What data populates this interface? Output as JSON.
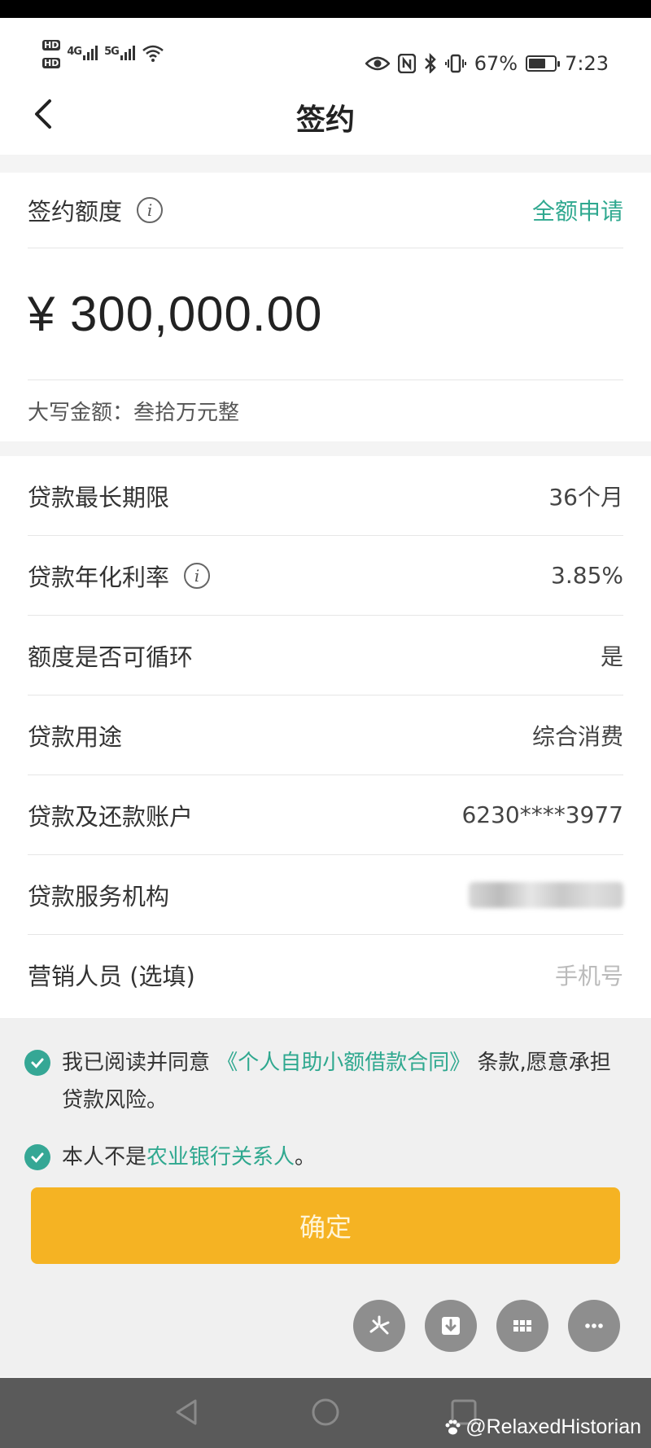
{
  "status_bar": {
    "hd1": "HD",
    "hd2": "HD",
    "net1": "4G",
    "net2": "5G",
    "battery": "67%",
    "time": "7:23"
  },
  "nav": {
    "title": "签约"
  },
  "quota": {
    "label": "签约额度",
    "full_apply": "全额申请",
    "amount": "¥ 300,000.00",
    "caps_label": "大写金额：",
    "caps_value": "叁拾万元整"
  },
  "details": [
    {
      "label": "贷款最长期限",
      "value": "36个月"
    },
    {
      "label": "贷款年化利率",
      "value": "3.85%"
    },
    {
      "label": "额度是否可循环",
      "value": "是"
    },
    {
      "label": "贷款用途",
      "value": "综合消费"
    },
    {
      "label": "贷款及还款账户",
      "value": "6230****3977"
    },
    {
      "label": "贷款服务机构",
      "value": ""
    },
    {
      "label": "营销人员 (选填)",
      "placeholder": "手机号"
    }
  ],
  "agreements": {
    "a1_prefix": "我已阅读并同意 ",
    "a1_link": "《个人自助小额借款合同》",
    "a1_suffix": " 条款,愿意承担贷款风险。",
    "a2_prefix": "本人不是",
    "a2_link": "农业银行关系人",
    "a2_suffix": "。"
  },
  "confirm_label": "确定",
  "watermark": "@RelaxedHistorian",
  "colors": {
    "accent_green": "#2fa88f",
    "button_orange": "#f5b323"
  }
}
